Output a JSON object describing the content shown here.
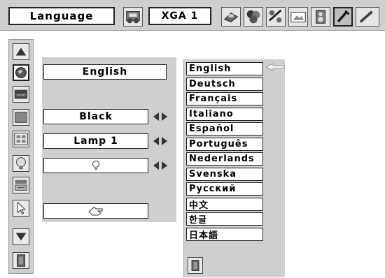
{
  "menu": {
    "title": "Language",
    "input_mode": "XGA 1"
  },
  "settings": {
    "language_value": "English",
    "color_value": "Black",
    "lamp_value": "Lamp 1"
  },
  "languages": [
    "English",
    "Deutsch",
    "Français",
    "Italiano",
    "Español",
    "Português",
    "Nederlands",
    "Svenska",
    "Русский",
    "中文",
    "한글",
    "日本語"
  ],
  "selected_language": "English",
  "icons": {
    "toolbar": [
      "input-icon",
      "pc-adjust-icon",
      "image-select-icon",
      "screen-icon",
      "image-adjust-icon",
      "sound-icon",
      "setting-icon"
    ],
    "left": [
      "up-arrow-icon",
      "language-globe-icon",
      "logo-icon",
      "background-icon",
      "display-icon",
      "lamp-icon",
      "power-management-icon",
      "pointer-icon",
      "down-arrow-icon",
      "exit-icon"
    ]
  },
  "colors": {
    "bar": "#cfcfcf",
    "field": "#ffffff",
    "border": "#222222"
  }
}
